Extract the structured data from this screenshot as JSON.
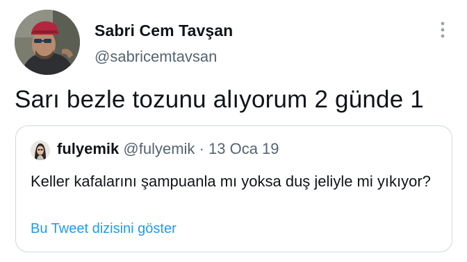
{
  "tweet": {
    "author": {
      "display_name": "Sabri Cem Tavşan",
      "handle": "@sabricemtavsan",
      "avatar_icon": "profile-photo"
    },
    "menu_icon": "more-vertical-icon",
    "text": "Sarı bezle tozunu alıyorum 2 günde 1",
    "quoted_tweet": {
      "author": {
        "display_name": "fulyemik",
        "handle": "@fulyemik",
        "avatar_icon": "profile-photo"
      },
      "separator": "·",
      "date": "13 Oca 19",
      "text": "Keller kafalarını şampuanla mı yoksa duş jeliyle mi yıkıyor?",
      "show_thread_label": "Bu Tweet dizisini göster"
    }
  },
  "colors": {
    "text_primary": "#0f1419",
    "text_secondary": "#536471",
    "link": "#1d9bf0",
    "card_border": "#cfd9de"
  }
}
